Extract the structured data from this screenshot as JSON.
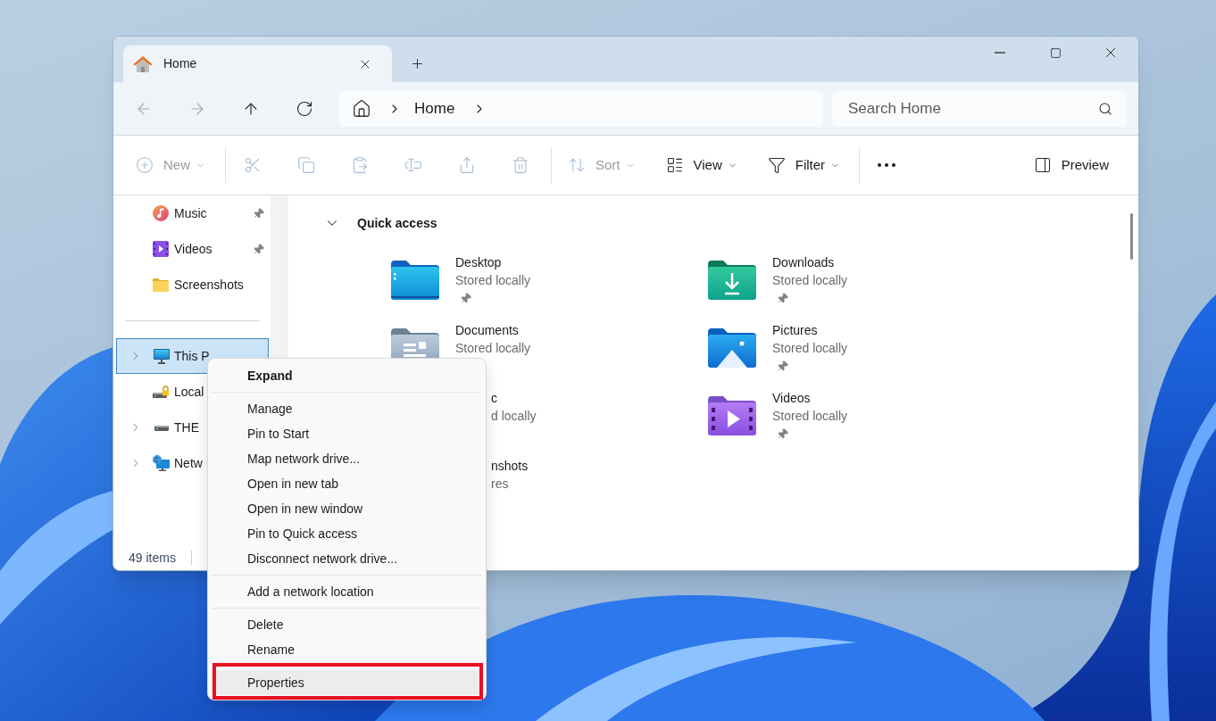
{
  "window": {
    "tabs": [
      {
        "label": "Home",
        "selected": true
      }
    ]
  },
  "nav_buttons": [
    {
      "disabled": true
    },
    {
      "disabled": true
    },
    {
      "disabled": false
    },
    {
      "disabled": false
    }
  ],
  "address_bar": {
    "crumbs": [
      "Home"
    ]
  },
  "search": {
    "placeholder": "Search Home"
  },
  "toolbar": {
    "groups": [
      [
        {
          "label": "New",
          "dropdown": true,
          "disabled": true
        }
      ],
      [
        {
          "disabled": true
        },
        {
          "disabled": true
        },
        {
          "disabled": true
        },
        {
          "disabled": true
        },
        {
          "disabled": true
        },
        {
          "disabled": true
        }
      ],
      [
        {
          "label": "Sort",
          "dropdown": true,
          "disabled": true
        },
        {
          "label": "View",
          "dropdown": true,
          "disabled": false
        },
        {
          "label": "Filter",
          "dropdown": true,
          "disabled": false
        }
      ],
      [
        {
          "disabled": false
        }
      ]
    ],
    "preview": {
      "label": "Preview"
    }
  },
  "sidebar": {
    "pinned": [
      {
        "label": "Music",
        "pinned": true,
        "selected": false
      },
      {
        "label": "Videos",
        "pinned": true,
        "selected": false
      },
      {
        "label": "Screenshots",
        "pinned": false,
        "selected": false
      }
    ],
    "locations": [
      {
        "label": "This P",
        "expandable": true,
        "selected": true
      },
      {
        "label": "Local",
        "expandable": false,
        "selected": false
      },
      {
        "label": "THE",
        "expandable": true,
        "selected": false
      },
      {
        "label": "Netw",
        "expandable": true,
        "selected": false
      }
    ]
  },
  "quick_access": {
    "title": "Quick access",
    "expanded": true,
    "items": [
      {
        "name": "Desktop",
        "detail": "Stored locally",
        "pinned": true,
        "under_menu": false
      },
      {
        "name": "Downloads",
        "detail": "Stored locally",
        "pinned": true,
        "under_menu": false
      },
      {
        "name": "Documents",
        "detail": "Stored locally",
        "pinned": false,
        "under_menu": false
      },
      {
        "name": "Pictures",
        "detail": "Stored locally",
        "pinned": true,
        "under_menu": false
      },
      {
        "name": "c",
        "detail": "d locally",
        "pinned": false,
        "under_menu": true
      },
      {
        "name": "Videos",
        "detail": "Stored locally",
        "pinned": true,
        "under_menu": false
      },
      {
        "name": "nshots",
        "detail": "res",
        "pinned": false,
        "under_menu": true
      }
    ]
  },
  "status_bar": {
    "item_count": "49 items"
  },
  "context_menu": {
    "groups": [
      [
        {
          "label": "Expand",
          "default": true,
          "hovered": false,
          "framed": false
        }
      ],
      [
        {
          "label": "Manage",
          "default": false,
          "hovered": false,
          "framed": false
        },
        {
          "label": "Pin to Start",
          "default": false,
          "hovered": false,
          "framed": false
        },
        {
          "label": "Map network drive...",
          "default": false,
          "hovered": false,
          "framed": false
        },
        {
          "label": "Open in new tab",
          "default": false,
          "hovered": false,
          "framed": false
        },
        {
          "label": "Open in new window",
          "default": false,
          "hovered": false,
          "framed": false
        },
        {
          "label": "Pin to Quick access",
          "default": false,
          "hovered": false,
          "framed": false
        },
        {
          "label": "Disconnect network drive...",
          "default": false,
          "hovered": false,
          "framed": false
        }
      ],
      [
        {
          "label": "Add a network location",
          "default": false,
          "hovered": false,
          "framed": false
        }
      ],
      [
        {
          "label": "Delete",
          "default": false,
          "hovered": false,
          "framed": false
        },
        {
          "label": "Rename",
          "default": false,
          "hovered": false,
          "framed": false
        }
      ],
      [
        {
          "label": "Properties",
          "default": false,
          "hovered": true,
          "framed": true
        }
      ]
    ]
  }
}
